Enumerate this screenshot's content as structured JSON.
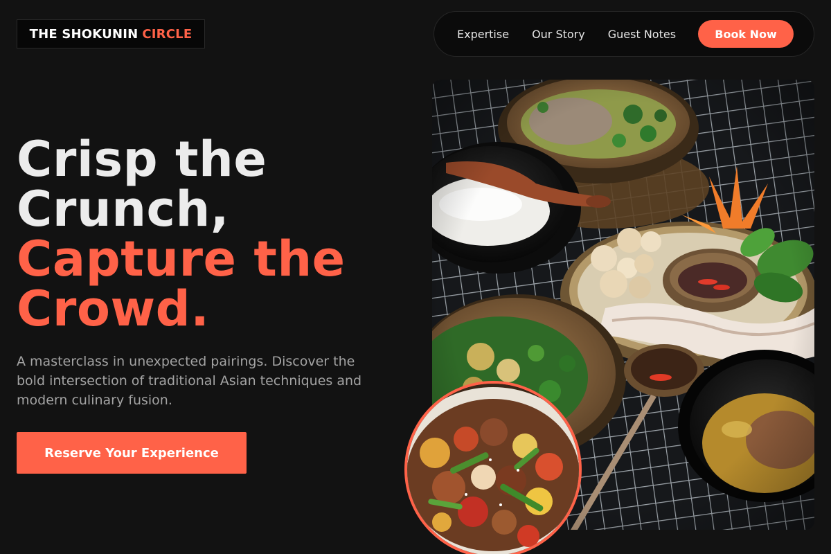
{
  "brand": {
    "name_main": "THE SHOKUNIN",
    "name_accent": "CIRCLE"
  },
  "nav": {
    "links": [
      "Expertise",
      "Our Story",
      "Guest Notes"
    ],
    "cta_label": "Book Now"
  },
  "hero": {
    "headline_lines": [
      "Crisp the",
      "Crunch,",
      "Capture the",
      "Crowd."
    ],
    "description": "A masterclass in unexpected pairings. Discover the bold intersection of traditional Asian techniques and modern culinary fusion.",
    "cta_label": "Reserve Your Experience"
  },
  "colors": {
    "background": "#121212",
    "accent": "#ff6248",
    "text": "#ececec",
    "muted_text": "#a3a3a3"
  },
  "images": {
    "main": "food-spread-photo",
    "inset": "stir-fry-photo"
  }
}
